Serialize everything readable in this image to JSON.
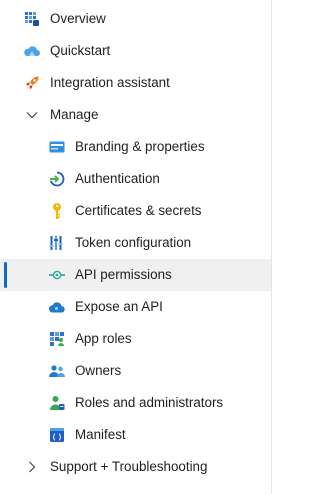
{
  "nav": {
    "overview": "Overview",
    "quickstart": "Quickstart",
    "integration_assistant": "Integration assistant",
    "manage": {
      "label": "Manage",
      "items": [
        {
          "label": "Branding & properties",
          "icon": "branding-card-icon"
        },
        {
          "label": "Authentication",
          "icon": "authentication-arrow-icon"
        },
        {
          "label": "Certificates & secrets",
          "icon": "key-icon"
        },
        {
          "label": "Token configuration",
          "icon": "token-bars-icon"
        },
        {
          "label": "API permissions",
          "icon": "api-permissions-icon",
          "selected": true
        },
        {
          "label": "Expose an API",
          "icon": "cloud-icon"
        },
        {
          "label": "App roles",
          "icon": "app-roles-grid-icon"
        },
        {
          "label": "Owners",
          "icon": "owners-people-icon"
        },
        {
          "label": "Roles and administrators",
          "icon": "roles-admin-person-icon"
        },
        {
          "label": "Manifest",
          "icon": "manifest-icon"
        }
      ]
    },
    "support": "Support + Troubleshooting"
  },
  "colors": {
    "accent": "#0f6cbd",
    "selected_bg": "#f0f0f0"
  }
}
